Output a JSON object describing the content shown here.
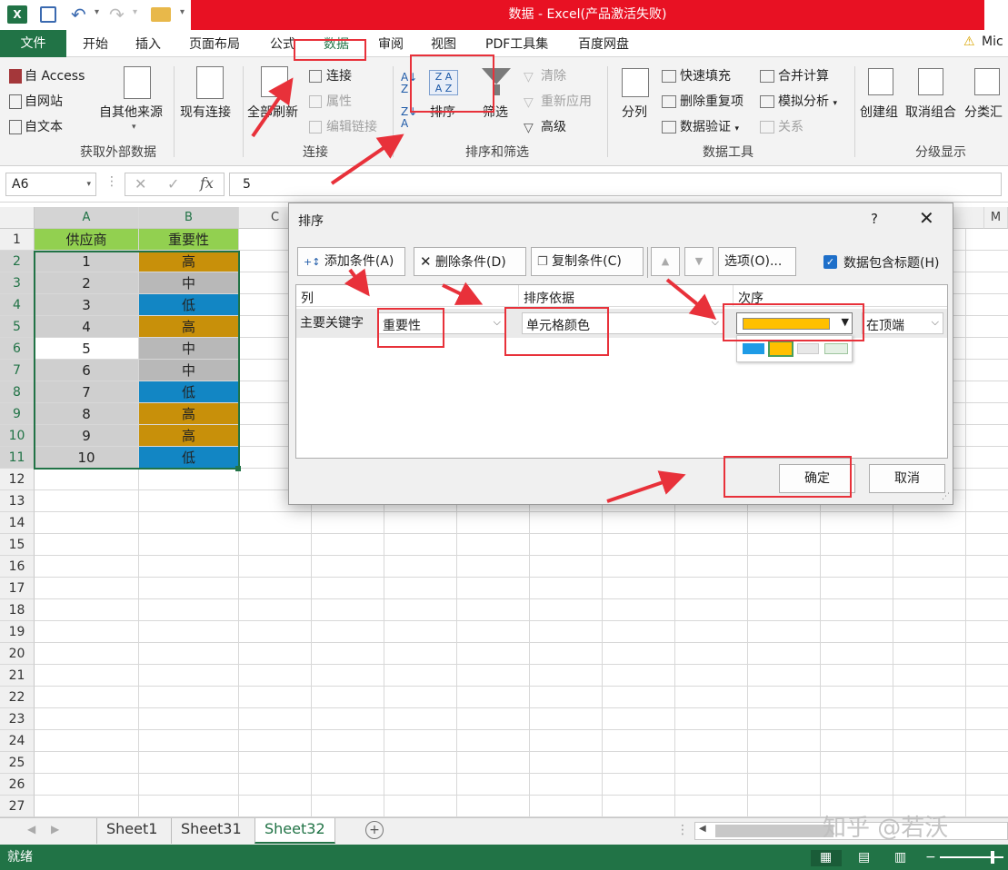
{
  "window": {
    "title": "数据 -  Excel(产品激活失败)",
    "account": "Mic"
  },
  "tabs": [
    "文件",
    "开始",
    "插入",
    "页面布局",
    "公式",
    "数据",
    "审阅",
    "视图",
    "PDF工具集",
    "百度网盘"
  ],
  "ribbon": {
    "external": {
      "access": "自 Access",
      "web": "自网站",
      "text": "自文本",
      "other": "自其他来源",
      "existing": "现有连接",
      "group": "获取外部数据"
    },
    "connections": {
      "refresh": "全部刷新",
      "connect": "连接",
      "properties": "属性",
      "edit_links": "编辑链接",
      "group": "连接"
    },
    "sortfilter": {
      "sort": "排序",
      "filter": "筛选",
      "clear": "清除",
      "reapply": "重新应用",
      "advanced": "高级",
      "group": "排序和筛选"
    },
    "datatools": {
      "split": "分列",
      "flash_fill": "快速填充",
      "remove_dup": "删除重复项",
      "validation": "数据验证",
      "consolidate": "合并计算",
      "whatif": "模拟分析",
      "relations": "关系",
      "group": "数据工具"
    },
    "outline": {
      "group_btn": "创建组",
      "ungroup": "取消组合",
      "subtotal": "分类汇",
      "group": "分级显示"
    }
  },
  "formula": {
    "namebox": "A6",
    "value": "5"
  },
  "columns": [
    "A",
    "B",
    "C",
    "M"
  ],
  "rows": [
    "1",
    "2",
    "3",
    "4",
    "5",
    "6",
    "7",
    "8",
    "9",
    "10",
    "11",
    "12",
    "13",
    "14",
    "15",
    "16",
    "17",
    "18",
    "19",
    "20",
    "21",
    "22",
    "23",
    "24",
    "25",
    "26",
    "27"
  ],
  "table": {
    "header": [
      "供应商",
      "重要性"
    ],
    "rows": [
      [
        "1",
        "高"
      ],
      [
        "2",
        "中"
      ],
      [
        "3",
        "低"
      ],
      [
        "4",
        "高"
      ],
      [
        "5",
        "中"
      ],
      [
        "6",
        "中"
      ],
      [
        "7",
        "低"
      ],
      [
        "8",
        "高"
      ],
      [
        "9",
        "高"
      ],
      [
        "10",
        "低"
      ]
    ]
  },
  "colors": {
    "high": "#c8900a",
    "mid": "#b8b8b8",
    "low": "#1286c4",
    "header": "#92d050",
    "excel_green": "#217346",
    "title_red": "#e81123",
    "highlight": "#e8313a",
    "swatch_orange": "#ffc000",
    "swatch_blue": "#1e9be6"
  },
  "dialog": {
    "title": "排序",
    "help": "?",
    "add": "添加条件(A)",
    "delete": "删除条件(D)",
    "copy": "复制条件(C)",
    "options": "选项(O)...",
    "has_header": "数据包含标题(H)",
    "col_header": "列",
    "sorton_header": "排序依据",
    "order_header": "次序",
    "row_label": "主要关键字",
    "column_value": "重要性",
    "sorton_value": "单元格颜色",
    "position_value": "在顶端",
    "ok": "确定",
    "cancel": "取消"
  },
  "sheets": [
    "Sheet1",
    "Sheet31",
    "Sheet32"
  ],
  "active_sheet": "Sheet32",
  "status": "就绪",
  "watermark": "知乎 @若沃"
}
